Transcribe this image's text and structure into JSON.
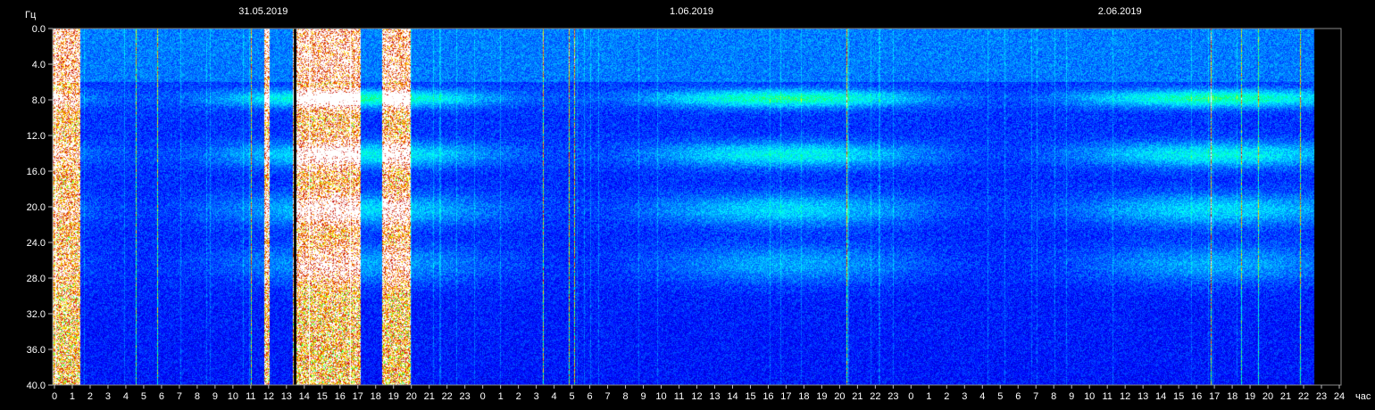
{
  "chart_data": {
    "type": "heatmap",
    "title": "",
    "ylabel": "Гц",
    "xlabel": "час",
    "ylim": [
      0,
      40
    ],
    "y_ticks": [
      "0.0",
      "4.0",
      "8.0",
      "12.0",
      "16.0",
      "20.0",
      "24.0",
      "28.0",
      "32.0",
      "36.0",
      "40.0"
    ],
    "x_hour_ticks": [
      "0",
      "1",
      "2",
      "3",
      "4",
      "5",
      "6",
      "7",
      "8",
      "9",
      "10",
      "11",
      "12",
      "13",
      "14",
      "15",
      "16",
      "17",
      "18",
      "19",
      "20",
      "21",
      "22",
      "23",
      "0",
      "1",
      "2",
      "3",
      "4",
      "5",
      "6",
      "7",
      "8",
      "9",
      "10",
      "11",
      "12",
      "13",
      "14",
      "15",
      "16",
      "17",
      "18",
      "19",
      "20",
      "21",
      "22",
      "23",
      "0",
      "1",
      "2",
      "3",
      "4",
      "5",
      "6",
      "7",
      "8",
      "9",
      "10",
      "11",
      "12",
      "13",
      "14",
      "15",
      "16",
      "17",
      "18",
      "19",
      "20",
      "21",
      "22",
      "23",
      "24"
    ],
    "date_labels": [
      {
        "text": "31.05.2019",
        "hour": 12
      },
      {
        "text": "1.06.2019",
        "hour": 36
      },
      {
        "text": "2.06.2019",
        "hour": 60
      }
    ],
    "data_end_hour": 70.5,
    "dominant_bands_hz": [
      7.8,
      14.1,
      20.3,
      26.4
    ],
    "interference_windows_hours": [
      [
        0,
        1.5
      ],
      [
        11.8,
        12.1
      ],
      [
        13.4,
        17.2
      ],
      [
        18.4,
        20
      ]
    ],
    "black_gap_hour": 13.5,
    "colormap": [
      "#000080",
      "#0000ff",
      "#0080ff",
      "#00ffff",
      "#00ff80",
      "#ffff00",
      "#ff8000",
      "#c00000",
      "#ffffff"
    ],
    "grid": false
  }
}
